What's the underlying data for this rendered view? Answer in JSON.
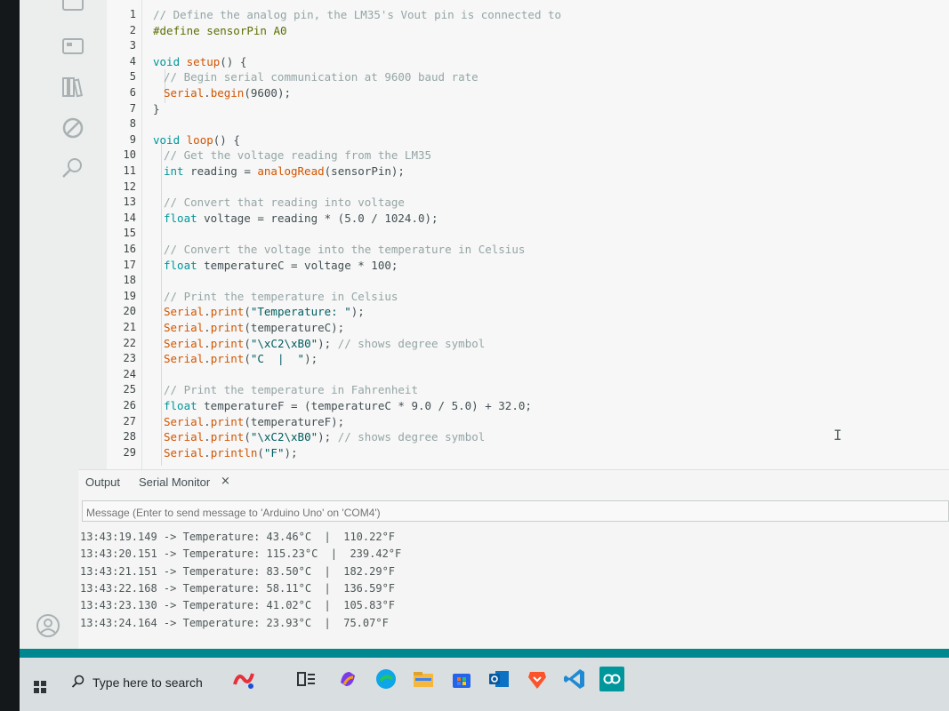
{
  "editor": {
    "lines": [
      {
        "n": "1",
        "indent": 0,
        "tokens": [
          {
            "t": "// Define the analog pin, the LM35's Vout pin is connected to",
            "c": "comment"
          }
        ]
      },
      {
        "n": "2",
        "indent": 0,
        "tokens": [
          {
            "t": "#define sensorPin A0",
            "c": "pp"
          }
        ]
      },
      {
        "n": "3",
        "indent": 0,
        "tokens": []
      },
      {
        "n": "4",
        "indent": 0,
        "tokens": [
          {
            "t": "void ",
            "c": "kw"
          },
          {
            "t": "setup",
            "c": "fn"
          },
          {
            "t": "() {",
            "c": "plain"
          }
        ]
      },
      {
        "n": "5",
        "indent": 1,
        "tokens": [
          {
            "t": "// Begin serial communication at 9600 baud rate",
            "c": "comment"
          }
        ]
      },
      {
        "n": "6",
        "indent": 1,
        "tokens": [
          {
            "t": "Serial",
            "c": "fn"
          },
          {
            "t": ".",
            "c": "plain"
          },
          {
            "t": "begin",
            "c": "fn"
          },
          {
            "t": "(9600);",
            "c": "plain"
          }
        ]
      },
      {
        "n": "7",
        "indent": 0,
        "tokens": [
          {
            "t": "}",
            "c": "plain"
          }
        ]
      },
      {
        "n": "8",
        "indent": 0,
        "tokens": []
      },
      {
        "n": "9",
        "indent": 0,
        "tokens": [
          {
            "t": "void ",
            "c": "kw"
          },
          {
            "t": "loop",
            "c": "fn"
          },
          {
            "t": "() {",
            "c": "plain"
          }
        ]
      },
      {
        "n": "10",
        "indent": 1,
        "tokens": [
          {
            "t": "// Get the voltage reading from the LM35",
            "c": "comment"
          }
        ]
      },
      {
        "n": "11",
        "indent": 1,
        "tokens": [
          {
            "t": "int ",
            "c": "kw"
          },
          {
            "t": "reading = ",
            "c": "plain"
          },
          {
            "t": "analogRead",
            "c": "fn"
          },
          {
            "t": "(sensorPin);",
            "c": "plain"
          }
        ]
      },
      {
        "n": "12",
        "indent": 0,
        "tokens": []
      },
      {
        "n": "13",
        "indent": 1,
        "tokens": [
          {
            "t": "// Convert that reading into voltage",
            "c": "comment"
          }
        ]
      },
      {
        "n": "14",
        "indent": 1,
        "tokens": [
          {
            "t": "float ",
            "c": "kw"
          },
          {
            "t": "voltage = reading * (5.0 / 1024.0);",
            "c": "plain"
          }
        ]
      },
      {
        "n": "15",
        "indent": 0,
        "tokens": []
      },
      {
        "n": "16",
        "indent": 1,
        "tokens": [
          {
            "t": "// Convert the voltage into the temperature in Celsius",
            "c": "comment"
          }
        ]
      },
      {
        "n": "17",
        "indent": 1,
        "tokens": [
          {
            "t": "float ",
            "c": "kw"
          },
          {
            "t": "temperatureC = voltage * 100;",
            "c": "plain"
          }
        ]
      },
      {
        "n": "18",
        "indent": 0,
        "tokens": []
      },
      {
        "n": "19",
        "indent": 1,
        "tokens": [
          {
            "t": "// Print the temperature in Celsius",
            "c": "comment"
          }
        ]
      },
      {
        "n": "20",
        "indent": 1,
        "tokens": [
          {
            "t": "Serial",
            "c": "fn"
          },
          {
            "t": ".",
            "c": "plain"
          },
          {
            "t": "print",
            "c": "fn"
          },
          {
            "t": "(",
            "c": "plain"
          },
          {
            "t": "\"Temperature: \"",
            "c": "str"
          },
          {
            "t": ");",
            "c": "plain"
          }
        ]
      },
      {
        "n": "21",
        "indent": 1,
        "tokens": [
          {
            "t": "Serial",
            "c": "fn"
          },
          {
            "t": ".",
            "c": "plain"
          },
          {
            "t": "print",
            "c": "fn"
          },
          {
            "t": "(temperatureC);",
            "c": "plain"
          }
        ]
      },
      {
        "n": "22",
        "indent": 1,
        "tokens": [
          {
            "t": "Serial",
            "c": "fn"
          },
          {
            "t": ".",
            "c": "plain"
          },
          {
            "t": "print",
            "c": "fn"
          },
          {
            "t": "(",
            "c": "plain"
          },
          {
            "t": "\"\\xC2\\xB0\"",
            "c": "str"
          },
          {
            "t": "); ",
            "c": "plain"
          },
          {
            "t": "// shows degree symbol",
            "c": "comment"
          }
        ]
      },
      {
        "n": "23",
        "indent": 1,
        "tokens": [
          {
            "t": "Serial",
            "c": "fn"
          },
          {
            "t": ".",
            "c": "plain"
          },
          {
            "t": "print",
            "c": "fn"
          },
          {
            "t": "(",
            "c": "plain"
          },
          {
            "t": "\"C  |  \"",
            "c": "str"
          },
          {
            "t": ");",
            "c": "plain"
          }
        ]
      },
      {
        "n": "24",
        "indent": 0,
        "tokens": []
      },
      {
        "n": "25",
        "indent": 1,
        "tokens": [
          {
            "t": "// Print the temperature in Fahrenheit",
            "c": "comment"
          }
        ]
      },
      {
        "n": "26",
        "indent": 1,
        "tokens": [
          {
            "t": "float ",
            "c": "kw"
          },
          {
            "t": "temperatureF = (temperatureC * 9.0 / 5.0) + 32.0;",
            "c": "plain"
          }
        ]
      },
      {
        "n": "27",
        "indent": 1,
        "tokens": [
          {
            "t": "Serial",
            "c": "fn"
          },
          {
            "t": ".",
            "c": "plain"
          },
          {
            "t": "print",
            "c": "fn"
          },
          {
            "t": "(temperatureF);",
            "c": "plain"
          }
        ]
      },
      {
        "n": "28",
        "indent": 1,
        "tokens": [
          {
            "t": "Serial",
            "c": "fn"
          },
          {
            "t": ".",
            "c": "plain"
          },
          {
            "t": "print",
            "c": "fn"
          },
          {
            "t": "(",
            "c": "plain"
          },
          {
            "t": "\"\\xC2\\xB0\"",
            "c": "str"
          },
          {
            "t": "); ",
            "c": "plain"
          },
          {
            "t": "// shows degree symbol",
            "c": "comment"
          }
        ]
      },
      {
        "n": "29",
        "indent": 1,
        "tokens": [
          {
            "t": "Serial",
            "c": "fn"
          },
          {
            "t": ".",
            "c": "plain"
          },
          {
            "t": "println",
            "c": "fn"
          },
          {
            "t": "(",
            "c": "plain"
          },
          {
            "t": "\"F\"",
            "c": "str"
          },
          {
            "t": ");",
            "c": "plain"
          }
        ]
      }
    ]
  },
  "panel": {
    "tab_output": "Output",
    "tab_serial": "Serial Monitor",
    "tab_close": "×",
    "message_placeholder": "Message (Enter to send message to 'Arduino Uno' on 'COM4')",
    "log": [
      {
        "time": "13:43:19.149",
        "c": "43.46°C",
        "f": "110.22°F"
      },
      {
        "time": "13:43:20.151",
        "c": "115.23°C",
        "f": "239.42°F"
      },
      {
        "time": "13:43:21.151",
        "c": "83.50°C",
        "f": "182.29°F"
      },
      {
        "time": "13:43:22.168",
        "c": "58.11°C",
        "f": "136.59°F"
      },
      {
        "time": "13:43:23.130",
        "c": "41.02°C",
        "f": "105.83°F"
      },
      {
        "time": "13:43:24.164",
        "c": "23.93°C",
        "f": "75.07°F"
      }
    ],
    "log_arrow": " -> ",
    "log_label": "Temperature: ",
    "log_sep": "  |  "
  },
  "taskbar": {
    "search_label": "Type here to search",
    "icons": [
      "music-app-icon",
      "task-view-icon",
      "copilot-icon",
      "edge-icon",
      "file-explorer-icon",
      "store-icon",
      "outlook-icon",
      "brave-icon",
      "vscode-icon",
      "arduino-ide-icon"
    ]
  },
  "colors": {
    "accent": "#00878f",
    "keyword": "#00979c",
    "function": "#d35400",
    "comment": "#95a5a6",
    "string": "#005c5f"
  }
}
